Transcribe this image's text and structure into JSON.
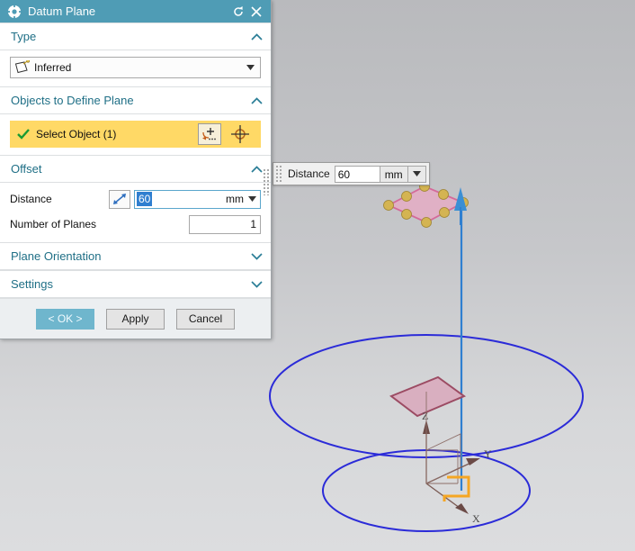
{
  "window": {
    "title": "Datum Plane",
    "icon": "gear-icon",
    "reset_icon": "reset-icon",
    "close_icon": "close-icon"
  },
  "sections": {
    "type": {
      "header": "Type",
      "collapsed": false,
      "chevron": "chevron-up-icon",
      "combo": {
        "value": "Inferred",
        "icon": "inferred-plane-icon",
        "arrow": "chevron-down-icon"
      }
    },
    "objects": {
      "header": "Objects to Define Plane",
      "collapsed": false,
      "chevron": "chevron-up-icon",
      "select_object": {
        "label": "Select Object (1)",
        "status_icon": "green-check-icon",
        "add_button_icon": "select-plus-icon",
        "snap_button_icon": "crosshair-target-icon"
      }
    },
    "offset": {
      "header": "Offset",
      "collapsed": false,
      "chevron": "chevron-up-icon",
      "distance": {
        "label": "Distance",
        "reverse_icon": "reverse-direction-icon",
        "value": "60",
        "unit": "mm",
        "unit_arrow": "chevron-down-icon"
      },
      "number_of_planes": {
        "label": "Number of Planes",
        "value": "1"
      }
    },
    "plane_orientation": {
      "header": "Plane Orientation",
      "collapsed": true,
      "chevron": "chevron-down-icon"
    },
    "settings": {
      "header": "Settings",
      "collapsed": true,
      "chevron": "chevron-down-icon"
    }
  },
  "footer": {
    "ok": "< OK >",
    "apply": "Apply",
    "cancel": "Cancel"
  },
  "floating_input": {
    "grip_icon": "drag-grip-icon",
    "label": "Distance",
    "value": "60",
    "unit": "mm",
    "arrow_icon": "chevron-down-icon"
  },
  "viewport": {
    "axis_labels": {
      "x": "X",
      "y": "Y",
      "z": "Z"
    },
    "colors": {
      "circle_blue": "#2b2bd8",
      "plane_pink_fill": "#d9a8bc",
      "plane_pink_stroke": "#9c4b63",
      "preview_plane_fill": "#eaa8c4",
      "preview_plane_stroke": "#d46a9a",
      "handle_gold": "#d4b452",
      "arrow_blue": "#2f7fd0",
      "axis_brown": "#6b4a46",
      "sketch_orange": "#f5a623",
      "background_top": "#b9babd",
      "background_bottom": "#dcdddf"
    }
  },
  "theme": {
    "titlebar": "#4f9cb5",
    "section_text": "#1f6f86",
    "highlight_yellow": "#ffd966",
    "primary_button": "#6fb6cd",
    "selection_blue": "#2f7fd0"
  }
}
